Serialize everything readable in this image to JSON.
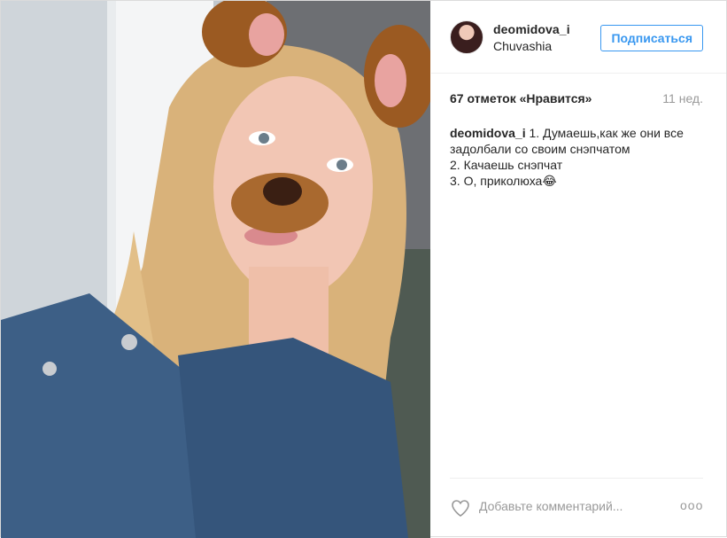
{
  "post": {
    "image_alt": "selfie photo with dog ears filter",
    "author": {
      "username": "deomidova_i",
      "location": "Chuvashia"
    },
    "follow_label": "Подписаться",
    "likes_text": "67 отметок «Нравится»",
    "time_ago": "11 нед.",
    "caption": {
      "username": "deomidova_i",
      "lines": [
        "1. Думаешь,как же они все",
        "задолбали со своим снэпчатом",
        "2. Качаешь снэпчат",
        "3. О, приколюха😂"
      ]
    },
    "comment_placeholder": "Добавьте комментарий...",
    "more_label": "ooo"
  },
  "icons": {
    "like": "heart-outline-icon",
    "more": "ellipsis-icon"
  },
  "colors": {
    "accent": "#3897f0",
    "text": "#262626",
    "muted": "#999999",
    "divider": "#efefef"
  }
}
